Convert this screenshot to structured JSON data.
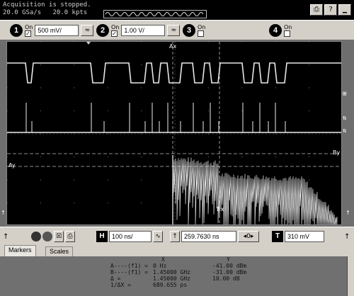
{
  "status": {
    "line1": "Acquisition is stopped.",
    "line2": "20.0 GSa/s   20.0 kpts"
  },
  "toolbar_icons": [
    {
      "name": "print-icon",
      "glyph": "⎙"
    },
    {
      "name": "help-icon",
      "glyph": "?"
    },
    {
      "name": "minimize-icon",
      "glyph": "▁"
    }
  ],
  "channels": [
    {
      "num": "1",
      "on_label": "On",
      "checked": true,
      "scale": "500 mV/",
      "show_scale": true
    },
    {
      "num": "2",
      "on_label": "On",
      "checked": true,
      "scale": "1.00 V/",
      "show_scale": true
    },
    {
      "num": "3",
      "on_label": "On",
      "checked": false,
      "scale": "",
      "show_scale": false
    },
    {
      "num": "4",
      "on_label": "On",
      "checked": false,
      "scale": "",
      "show_scale": false
    }
  ],
  "screen_labels": {
    "ax": "Ax",
    "bx": "Bx",
    "ay": "Ay",
    "by": "By"
  },
  "controls": {
    "horizontal_label": "H",
    "horizontal_scale": "100 ns/",
    "delay": "259.7630 ns",
    "trigger_label": "T",
    "trigger_level": "310 mV"
  },
  "tabs": [
    {
      "label": "Markers",
      "active": true
    },
    {
      "label": "Scales",
      "active": false
    }
  ],
  "markers": {
    "col_x": "X",
    "col_y": "Y",
    "rows": [
      {
        "label": "A----(f1) =",
        "x": "0 Hz",
        "y": "-41.00 dBm"
      },
      {
        "label": "B----(f1) =",
        "x": "1.45000 GHz",
        "y": "-31.00 dBm"
      },
      {
        "label": "Δ =",
        "x": "1.45000 GHz",
        "y": "10.00 dB"
      },
      {
        "label": "1/ΔX =",
        "x": "689.655 ps",
        "y": ""
      }
    ]
  }
}
